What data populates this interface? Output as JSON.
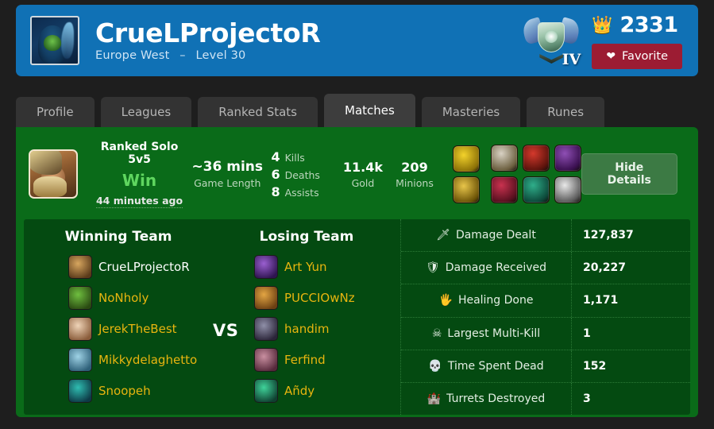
{
  "header": {
    "avatar_icon": "summoner-avatar",
    "name": "CrueLProjectoR",
    "region": "Europe West",
    "separator": "–",
    "level": "Level 30",
    "rank_emblem_icon": "diamond-rank-emblem",
    "rank_tier": "IV",
    "crown_icon": "crown-icon",
    "lp_value": "2331",
    "favorite_label": "Favorite",
    "favorite_heart_icon": "heart-icon",
    "colors": {
      "header_bg": "#1071b5",
      "favorite_bg": "#9c1c33"
    }
  },
  "tabs": [
    {
      "label": "Profile",
      "active": false
    },
    {
      "label": "Leagues",
      "active": false
    },
    {
      "label": "Ranked Stats",
      "active": false
    },
    {
      "label": "Matches",
      "active": true
    },
    {
      "label": "Masteries",
      "active": false
    },
    {
      "label": "Runes",
      "active": false
    }
  ],
  "match": {
    "champion_icon": "champion-portrait-tryndamere",
    "queue": "Ranked Solo 5v5",
    "result": "Win",
    "time_ago": "44 minutes ago",
    "game_length_value": "~36 mins",
    "game_length_label": "Game Length",
    "kda": [
      {
        "value": "4",
        "label": "Kills"
      },
      {
        "value": "6",
        "label": "Deaths"
      },
      {
        "value": "8",
        "label": "Assists"
      }
    ],
    "gold_value": "11.4k",
    "gold_label": "Gold",
    "minions_value": "209",
    "minions_label": "Minions",
    "summoner_spells": [
      {
        "name": "spell-flash-icon",
        "c1": "#f3d22b",
        "c2": "#8a6f06"
      },
      {
        "name": "spell-ghost-icon",
        "c1": "#e8c54a",
        "c2": "#6b5206"
      }
    ],
    "items": [
      {
        "name": "item-trinity-force-icon",
        "c1": "#d9d2c4",
        "c2": "#6c5f3f"
      },
      {
        "name": "item-bloodthirster-icon",
        "c1": "#d4392c",
        "c2": "#5d130c"
      },
      {
        "name": "item-long-sword-icon",
        "c1": "#8f4fb5",
        "c2": "#3a1050"
      },
      {
        "name": "item-phantom-dancer-icon",
        "c1": "#c9324f",
        "c2": "#58101f"
      },
      {
        "name": "item-ravenous-hydra-icon",
        "c1": "#2fae8a",
        "c2": "#0d4a3b"
      },
      {
        "name": "item-infinity-edge-icon",
        "c1": "#e8e8e8",
        "c2": "#5c5c5c"
      }
    ],
    "hide_details_label": "Hide Details"
  },
  "teams": {
    "winning_title": "Winning Team",
    "losing_title": "Losing Team",
    "vs_label": "VS",
    "winning": [
      {
        "name": "CrueLProjectoR",
        "self": true,
        "icon": "champion-icon-tryndamere",
        "c1": "#d7a65f",
        "c2": "#5a3a1a"
      },
      {
        "name": "NoNholy",
        "self": false,
        "icon": "champion-icon-renekton",
        "c1": "#6fbf3f",
        "c2": "#2a4a12"
      },
      {
        "name": "JerekTheBest",
        "self": false,
        "icon": "champion-icon-janna",
        "c1": "#efd4b8",
        "c2": "#8a5c3a"
      },
      {
        "name": "Mikkydelaghetto",
        "self": false,
        "icon": "champion-icon-sona",
        "c1": "#9fd3e6",
        "c2": "#2d5f78"
      },
      {
        "name": "Snoopeh",
        "self": false,
        "icon": "champion-icon-thresh",
        "c1": "#2fbdb1",
        "c2": "#0d3a46"
      }
    ],
    "losing": [
      {
        "name": "Art Yun",
        "icon": "champion-icon-velkoz",
        "c1": "#9a5fd0",
        "c2": "#2e1450"
      },
      {
        "name": "PUCCIOwNz",
        "icon": "champion-icon-garen",
        "c1": "#e3a543",
        "c2": "#6b3f12"
      },
      {
        "name": "handim",
        "icon": "champion-icon-jhin",
        "c1": "#8f8fa8",
        "c2": "#2a2438"
      },
      {
        "name": "Ferfind",
        "icon": "champion-icon-caitlyn",
        "c1": "#c98fa0",
        "c2": "#55283a"
      },
      {
        "name": "Añdy",
        "icon": "champion-icon-thresh",
        "c1": "#3fd39a",
        "c2": "#0f4030"
      }
    ]
  },
  "stats": [
    {
      "icon": "sword-icon",
      "glyph": "🗡",
      "label": "Damage Dealt",
      "value": "127,837"
    },
    {
      "icon": "shield-icon",
      "glyph": "🛡",
      "label": "Damage Received",
      "value": "20,227"
    },
    {
      "icon": "hand-icon",
      "glyph": "🖐",
      "label": "Healing Done",
      "value": "1,171"
    },
    {
      "icon": "multikill-icon",
      "glyph": "☠",
      "label": "Largest Multi-Kill",
      "value": "1"
    },
    {
      "icon": "skull-icon",
      "glyph": "💀",
      "label": "Time Spent Dead",
      "value": "152"
    },
    {
      "icon": "turret-icon",
      "glyph": "🏰",
      "label": "Turrets Destroyed",
      "value": "3"
    }
  ]
}
